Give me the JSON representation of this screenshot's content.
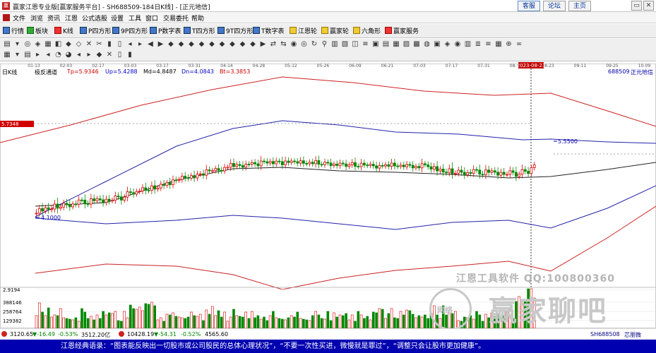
{
  "window": {
    "app_icon": "赢",
    "title": "赢家江恩专业版[赢家服务平台] - SH688509-184日K线] - [正元地信]",
    "links": [
      "客服",
      "论坛",
      "主页"
    ],
    "controls": [
      "▭",
      "✕"
    ]
  },
  "menu": [
    "文件",
    "浏览",
    "资讯",
    "江恩",
    "公式选股",
    "设置",
    "工具",
    "窗口",
    "交易委托",
    "帮助"
  ],
  "toolbar1": [
    {
      "label": "行情",
      "icon": "grid-icon",
      "color": "blue"
    },
    {
      "label": "板块",
      "icon": "blocks-icon",
      "color": "green"
    },
    {
      "label": "K线",
      "icon": "candle-icon",
      "color": "red"
    },
    {
      "label": "P四方形",
      "icon": "square-icon",
      "color": "blue"
    },
    {
      "label": "9P四方形",
      "icon": "square-icon",
      "color": "blue"
    },
    {
      "label": "P数字表",
      "icon": "table-icon",
      "color": "blue"
    },
    {
      "label": "T四方形",
      "icon": "square-icon",
      "color": "blue"
    },
    {
      "label": "9T四方形",
      "icon": "square-icon",
      "color": "blue"
    },
    {
      "label": "T数字表",
      "icon": "table-icon",
      "color": "blue"
    },
    {
      "label": "江恩轮",
      "icon": "wheel-icon",
      "color": "yellow"
    },
    {
      "label": "赢家轮",
      "icon": "wheel-icon",
      "color": "yellow"
    },
    {
      "label": "六角形",
      "icon": "hexagon-icon",
      "color": "yellow"
    },
    {
      "label": "赢家服务",
      "icon": "service-icon",
      "color": "red"
    }
  ],
  "toolbar2_row1": [
    "▤",
    "▾",
    "◎",
    "◈",
    "▦",
    "◧",
    "◆",
    "◇",
    "✕",
    "✂",
    "▮",
    "▯",
    "◂",
    "▸",
    "◀",
    "▶",
    "◆",
    "◆",
    "◆",
    "◆",
    "◆",
    "◆",
    "◆",
    "◆",
    "◆",
    "▶",
    "⇄",
    "⇆",
    "◉",
    "◎",
    "↻",
    "⚲",
    "▥",
    "▧",
    "◫",
    "≡",
    "▣",
    "▤",
    "▦",
    "▨",
    "▩",
    "◍",
    "▣",
    "◈",
    "◉",
    "▥",
    "≣",
    "≡",
    "▦",
    "⊕",
    "∞"
  ],
  "toolbar2_row2": [
    "▦",
    "▾",
    "▤",
    "▸",
    "◂",
    "◔",
    "◕",
    "◂",
    "▸",
    "◆",
    "✕",
    "▯",
    "▮"
  ],
  "chart": {
    "period_label": "日K线",
    "indicator_name": "极反通道",
    "indicators": [
      {
        "label": "Tp=5.9346",
        "color": "#cc0000"
      },
      {
        "label": "Up=5.4288",
        "color": "#0000cc"
      },
      {
        "label": "Md=4.8487",
        "color": "#000000"
      },
      {
        "label": "Dn=4.0843",
        "color": "#0000cc"
      },
      {
        "label": "Bt=3.3853",
        "color": "#cc0000"
      }
    ],
    "stock_code": "688509",
    "stock_name": "正元地信",
    "price_tag": "5.7348",
    "high_label": "5.5500",
    "low_label": "4.1000",
    "crosshair_date": "2023-08-23",
    "date_ticks": [
      "01-13",
      "02-03",
      "02-17",
      "03-03",
      "03-17",
      "03-31",
      "04-14",
      "04-28",
      "05-12",
      "05-26",
      "06-09",
      "06-21",
      "07-03",
      "07-17",
      "07-31",
      "08-14",
      "08-23",
      "09-11",
      "09-25",
      "10-09"
    ],
    "volume_labels": [
      "2.9194",
      "388146",
      "258764",
      "129382"
    ]
  },
  "status": {
    "sh_index": "3120.65",
    "sh_change": "▼-16.49",
    "sh_pct": "-0.53%",
    "sh_amount": "3512.20亿",
    "sz_index": "10428.19",
    "sz_change": "▼-54.31",
    "sz_pct": "-0.52%",
    "sz_amount": "4565.60",
    "right_code": "SH688508",
    "right_name": "芯朋微"
  },
  "watermark": {
    "top": "江恩工具软件 QQ:100800360",
    "badge": "网络",
    "big": "赢家聊吧"
  },
  "quote": "江恩经典语录：“图表能反映出一切股市或公司股民的总体心理状况”，“不要一次性买进，微慢就是罪过”，“调整只会让股市更加健康”。",
  "colors": {
    "up_candle": "#dd0000",
    "down_candle": "#008800",
    "channel_outer": "#cc2222",
    "channel_inner": "#2222aa",
    "channel_mid": "#222222",
    "quote_bar": "#0000b0"
  }
}
